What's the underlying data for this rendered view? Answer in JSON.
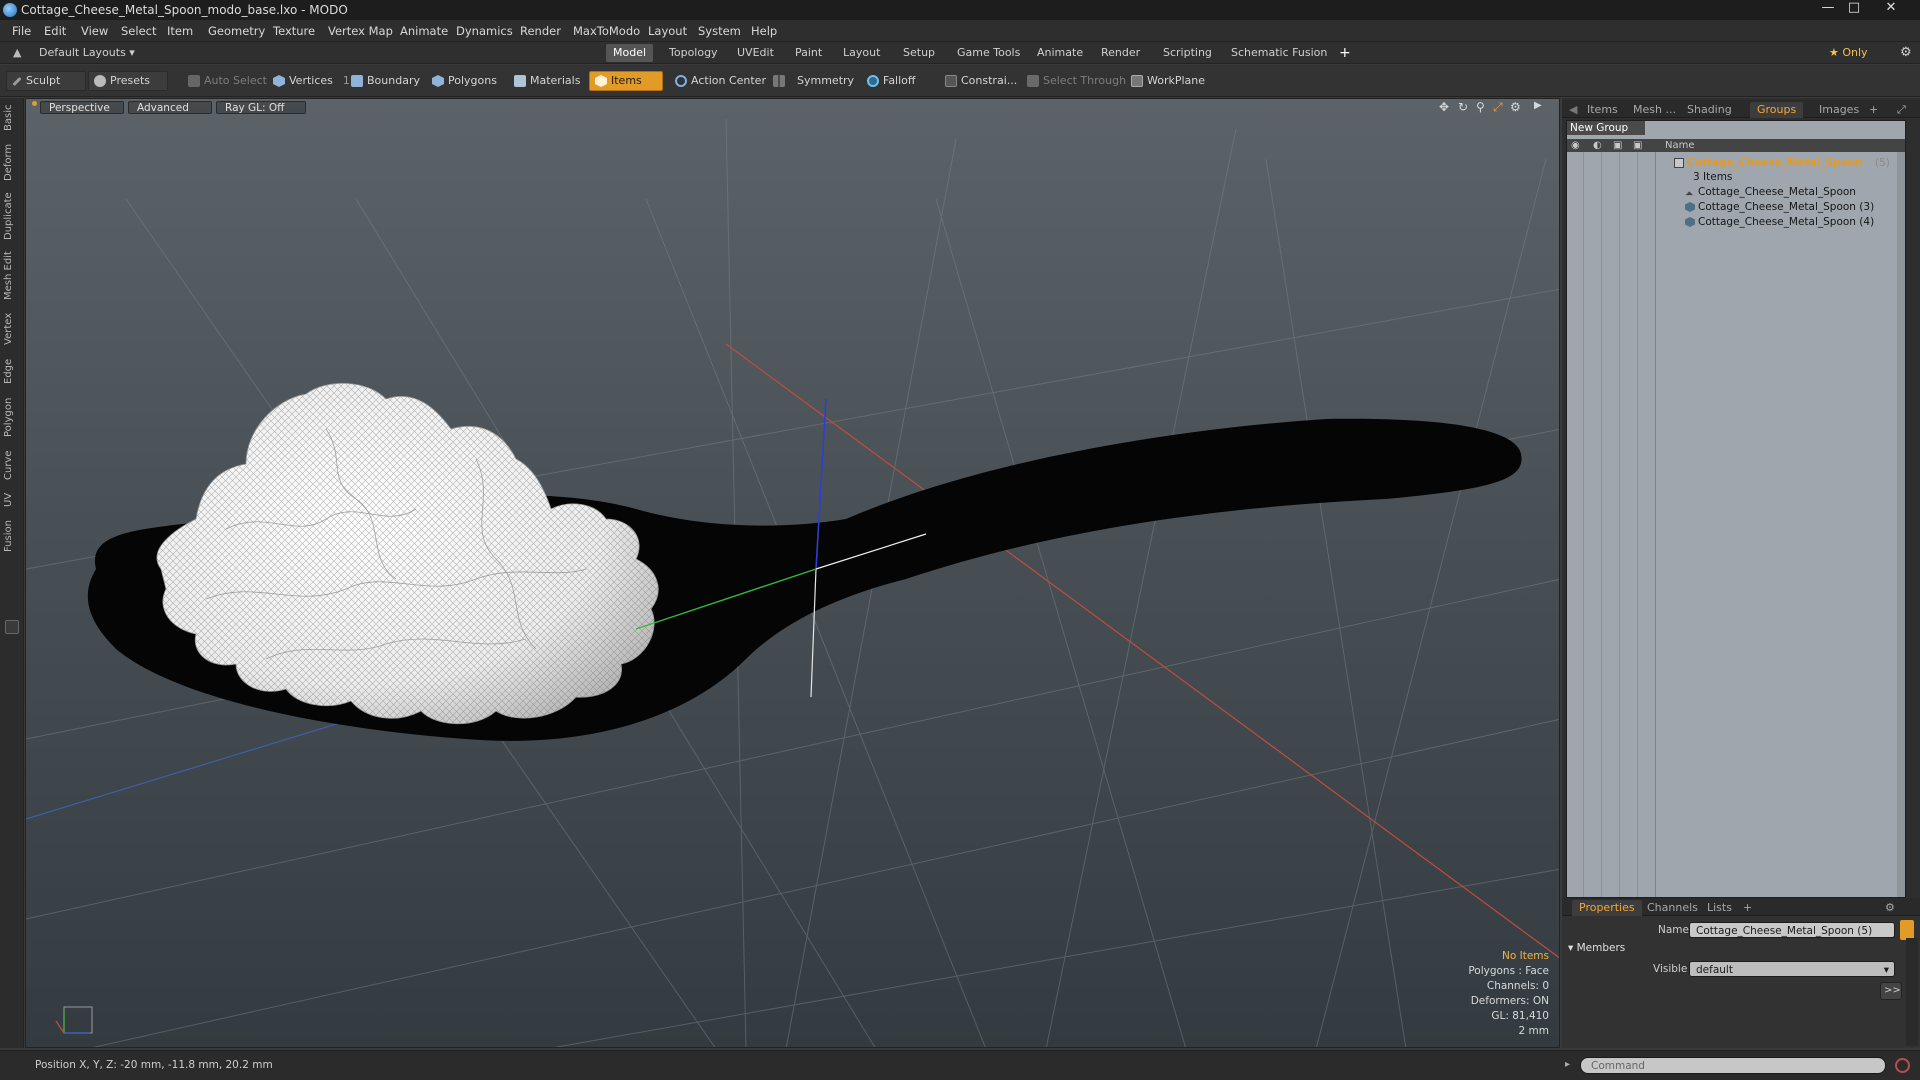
{
  "window": {
    "title": "Cottage_Cheese_Metal_Spoon_modo_base.lxo - MODO",
    "controls": [
      "—",
      "□",
      "✕"
    ]
  },
  "menu": [
    "File",
    "Edit",
    "View",
    "Select",
    "Item",
    "Geometry",
    "Texture",
    "Vertex Map",
    "Animate",
    "Dynamics",
    "Render",
    "MaxToModo",
    "Layout",
    "System",
    "Help"
  ],
  "layoutbar": {
    "layouts_label": "Default Layouts ▾",
    "tabs": [
      "Model",
      "Topology",
      "UVEdit",
      "Paint",
      "Layout",
      "Setup",
      "Game Tools",
      "Animate",
      "Render",
      "Scripting",
      "Schematic Fusion"
    ],
    "active_tab": "Model",
    "add_label": "+",
    "only_label": "★  Only",
    "settings_glyph": "⚙"
  },
  "toolbar": {
    "sculpt": "Sculpt",
    "presets": "Presets",
    "auto_select": "Auto Select",
    "vertices": "Vertices",
    "vertices_count": "1",
    "boundary": "Boundary",
    "polygons": "Polygons",
    "materials": "Materials",
    "items": "Items",
    "action_center": "Action Center",
    "symmetry": "Symmetry",
    "falloff": "Falloff",
    "constrain": "Constrai...",
    "select_through": "Select Through",
    "workplane": "WorkPlane"
  },
  "left_tabs": [
    "Basic",
    "Deform",
    "Duplicate",
    "Mesh Edit",
    "Vertex",
    "Edge",
    "Polygon",
    "Curve",
    "UV",
    "Fusion"
  ],
  "viewport": {
    "perspective": "Perspective",
    "advanced": "Advanced",
    "raygl": "Ray GL: Off",
    "info": {
      "no_items": "No Items",
      "polygons": "Polygons : Face",
      "channels": "Channels: 0",
      "deformers": "Deformers: ON",
      "gl": "GL: 81,410",
      "scale": "2 mm"
    }
  },
  "panel_tabs": [
    "Items",
    "Mesh ...",
    "Shading",
    "Groups",
    "Images"
  ],
  "panel_active_tab": "Groups",
  "groups": {
    "new_group": "New Group",
    "col_name": "Name",
    "root": "Cottage_Cheese_Metal_Spoon",
    "root_count": "(5)",
    "items_count": "3 Items",
    "children": [
      "Cottage_Cheese_Metal_Spoon",
      "Cottage_Cheese_Metal_Spoon (3)",
      "Cottage_Cheese_Metal_Spoon (4)"
    ]
  },
  "properties": {
    "tabs": [
      "Properties",
      "Channels",
      "Lists"
    ],
    "active_tab": "Properties",
    "name_label": "Name",
    "name_value": "Cottage_Cheese_Metal_Spoon (5)",
    "members_label": "Members",
    "visible_label": "Visible",
    "visible_value": "default",
    "more_button": ">>"
  },
  "statusbar": {
    "position": "Position X, Y, Z:  -20 mm, -11.8 mm, 20.2 mm",
    "command_placeholder": "Command"
  },
  "colors": {
    "accent": "#e39b28",
    "viewport_top": "#5c6368",
    "viewport_bottom": "#343b40",
    "group_panel": "#9fa6ad"
  }
}
